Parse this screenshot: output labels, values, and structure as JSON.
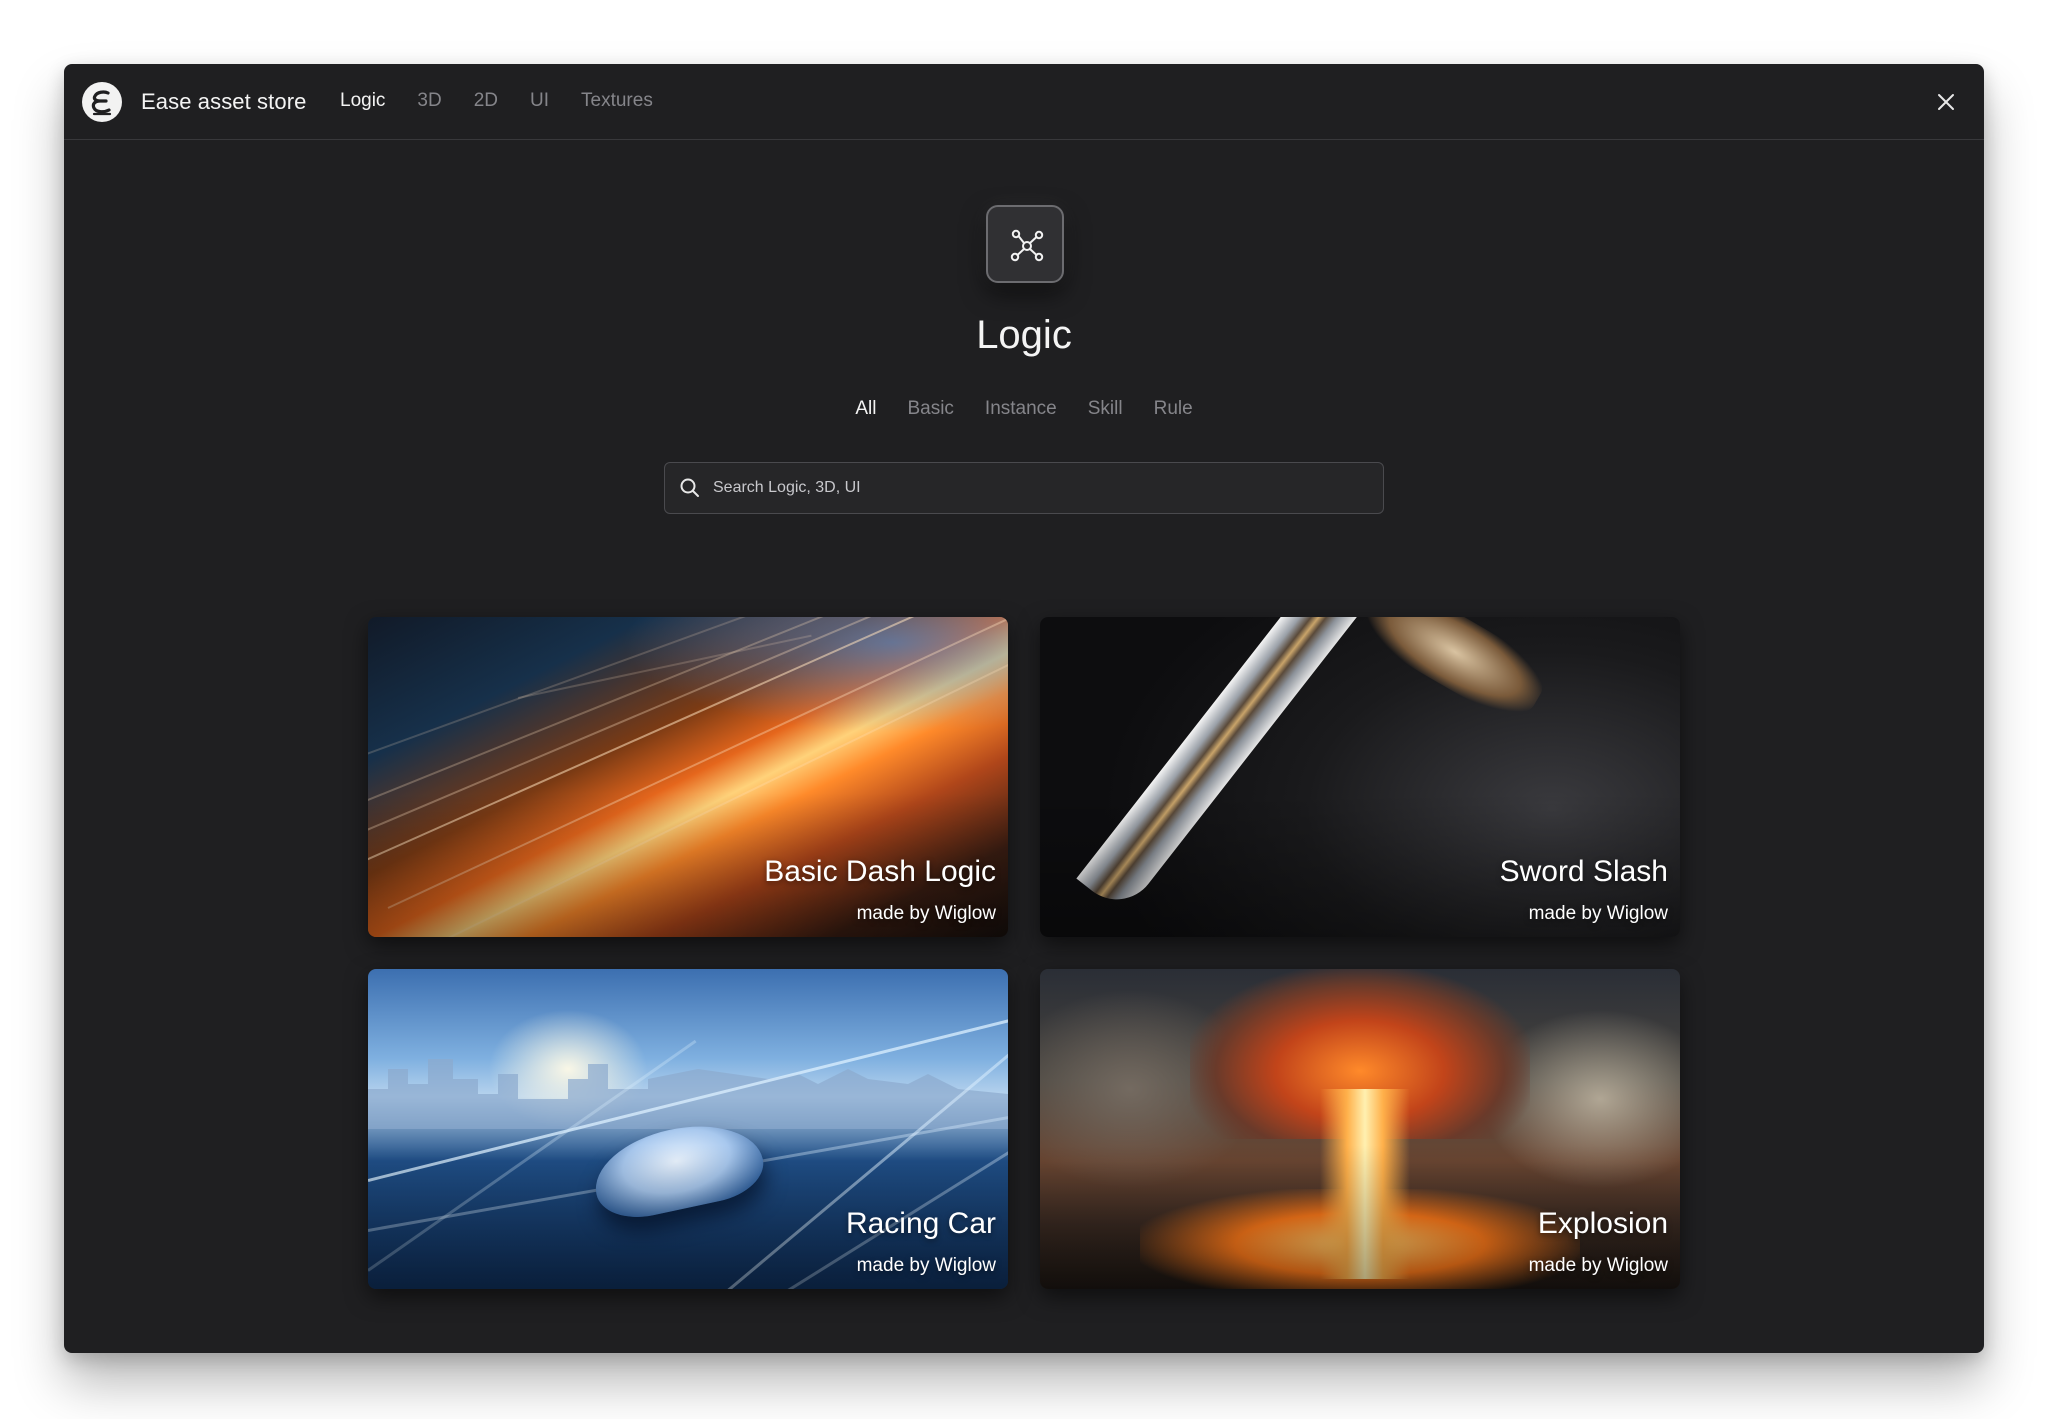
{
  "app": {
    "title": "Ease asset store",
    "close_icon": "close-icon",
    "logo_icon": "ease-logo-icon"
  },
  "nav": {
    "items": [
      {
        "label": "Logic",
        "active": true
      },
      {
        "label": "3D",
        "active": false
      },
      {
        "label": "2D",
        "active": false
      },
      {
        "label": "UI",
        "active": false
      },
      {
        "label": "Textures",
        "active": false
      }
    ]
  },
  "hero": {
    "icon": "node-graph-icon",
    "title": "Logic"
  },
  "filters": {
    "items": [
      {
        "label": "All",
        "active": true
      },
      {
        "label": "Basic",
        "active": false
      },
      {
        "label": "Instance",
        "active": false
      },
      {
        "label": "Skill",
        "active": false
      },
      {
        "label": "Rule",
        "active": false
      }
    ]
  },
  "search": {
    "placeholder": "Search Logic, 3D, UI",
    "value": "",
    "icon": "search-icon"
  },
  "cards": [
    {
      "title": "Basic Dash Logic",
      "author": "made by Wiglow",
      "image": "speed-streaks"
    },
    {
      "title": "Sword Slash",
      "author": "made by Wiglow",
      "image": "ornate-sword"
    },
    {
      "title": "Racing Car",
      "author": "made by Wiglow",
      "image": "racing-car"
    },
    {
      "title": "Explosion",
      "author": "made by Wiglow",
      "image": "mushroom-cloud"
    }
  ],
  "colors": {
    "background": "#1f1f21",
    "text_primary": "#f4f4f4",
    "text_muted": "#85858a",
    "border": "#38383b"
  }
}
